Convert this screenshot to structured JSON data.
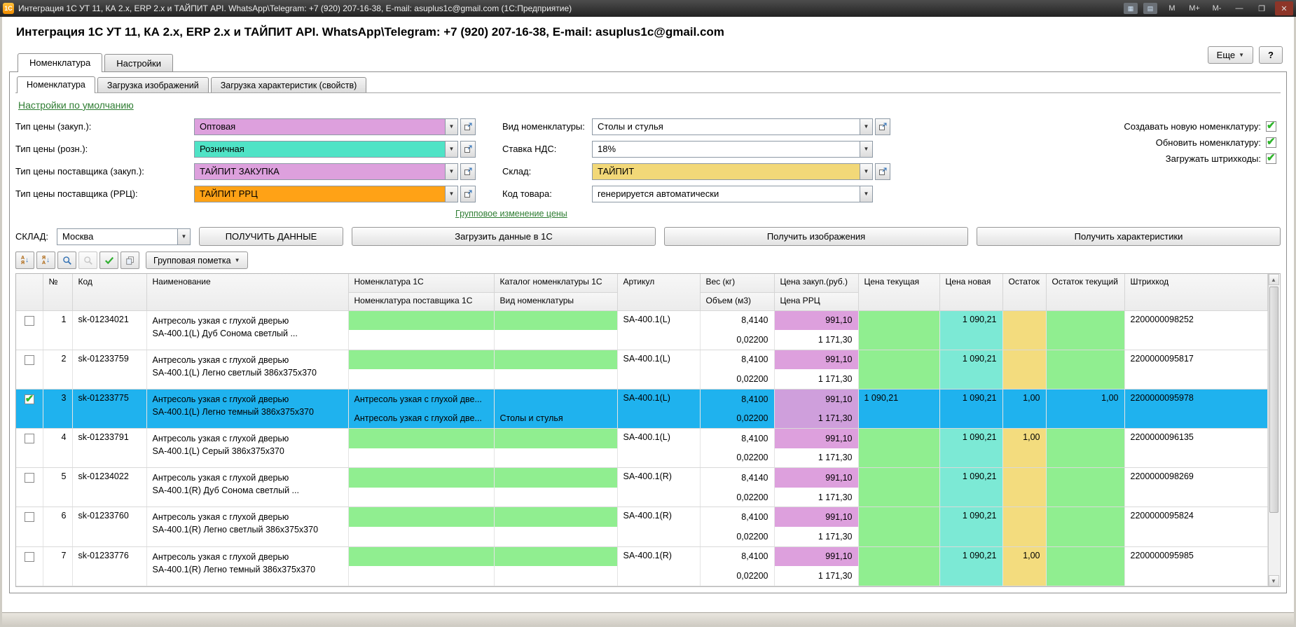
{
  "colors": {
    "selection": "#1fb2ee",
    "cell_green": "#90ee90",
    "cell_pink": "#dda0dd",
    "cell_cyan": "#7ce9d5",
    "cell_yellow": "#f3dc7e",
    "link_green": "#2e7d32",
    "check_green": "#2eb52a"
  },
  "titlebar": {
    "logo_text": "1С",
    "app_title": "Интеграция 1С УТ 11, КА 2.х, ERP 2.х и ТАЙПИТ API. WhatsApp\\Telegram: +7 (920) 207-16-38, E-mail: asuplus1c@gmail.com  (1С:Предприятие)",
    "scale_m": "М",
    "scale_m_plus": "М+",
    "scale_m_minus": "М-",
    "minimize": "—",
    "maximize": "❐",
    "close": "✕"
  },
  "header": {
    "title": "Интеграция 1С УТ 11, КА 2.х, ERP 2.х и ТАЙПИТ API. WhatsApp\\Telegram: +7 (920) 207-16-38, E-mail: asuplus1c@gmail.com",
    "more_button": "Еще",
    "help_button": "?"
  },
  "outer_tabs": [
    {
      "label": "Номенклатура",
      "active": true
    },
    {
      "label": "Настройки",
      "active": false
    }
  ],
  "inner_tabs": [
    {
      "label": "Номенклатура",
      "active": true
    },
    {
      "label": "Загрузка изображений",
      "active": false
    },
    {
      "label": "Загрузка характеристик (свойств)",
      "active": false
    }
  ],
  "links": {
    "default_settings": "Настройки по умолчанию",
    "group_price_change": "Групповое изменение цены"
  },
  "form": {
    "left": [
      {
        "label": "Тип цены (закуп.):",
        "value": "Оптовая",
        "color": "#dda0dd"
      },
      {
        "label": "Тип цены (розн.):",
        "value": "Розничная",
        "color": "#4fe3c6"
      },
      {
        "label": "Тип цены поставщика (закуп.):",
        "value": "ТАЙПИТ ЗАКУПКА",
        "color": "#dda0dd"
      },
      {
        "label": "Тип цены поставщика (РРЦ):",
        "value": "ТАЙПИТ РРЦ",
        "color": "#ffa216"
      }
    ],
    "middle": [
      {
        "label": "Вид номенклатуры:",
        "value": "Столы и стулья",
        "color": "#ffffff"
      },
      {
        "label": "Ставка НДС:",
        "value": "18%",
        "color": "#ffffff"
      },
      {
        "label": "Склад:",
        "value": "ТАЙПИТ",
        "color": "#f2d878"
      },
      {
        "label": "Код товара:",
        "value": "генерируется автоматически",
        "color": "#ffffff"
      }
    ],
    "checkboxes": [
      {
        "label": "Создавать новую номенклатуру:",
        "checked": true
      },
      {
        "label": "Обновить номенклатуру:",
        "checked": true
      },
      {
        "label": "Загружать штрихкоды:",
        "checked": true
      }
    ]
  },
  "actions": {
    "sklad_label": "СКЛАД:",
    "sklad_value": "Москва",
    "get_data": "ПОЛУЧИТЬ ДАННЫЕ",
    "load_to_1c": "Загрузить данные в 1С",
    "get_images": "Получить изображения",
    "get_characteristics": "Получить характеристики"
  },
  "toolbar": {
    "icons": [
      "sort-ascending",
      "sort-descending",
      "search",
      "search-cancel",
      "mark",
      "copy"
    ],
    "group_mark_label": "Групповая пометка"
  },
  "table": {
    "headers": {
      "num": "№",
      "code": "Код",
      "name": "Наименование",
      "nom_1c": "Номенклатура 1С",
      "nom_supplier": "Номенклатура поставщика 1С",
      "catalog": "Каталог номенклатуры 1С",
      "nom_type": "Вид номенклатуры",
      "article": "Артикул",
      "weight": "Вес (кг)",
      "volume": "Объем (м3)",
      "price_purchase": "Цена закуп.(руб.)",
      "price_rrc": "Цена РРЦ",
      "price_current": "Цена текущая",
      "price_new": "Цена новая",
      "stock": "Остаток",
      "stock_current": "Остаток текущий",
      "barcode": "Штрихкод"
    },
    "rows": [
      {
        "checked": false,
        "selected": false,
        "num": "1",
        "code": "sk-01234021",
        "name_line1": "Антресоль узкая с глухой дверью",
        "name_line2": "SA-400.1(L) Дуб Сонома светлый ...",
        "nom_1c": "",
        "nom_supplier": "",
        "catalog_1c": "",
        "nom_type": "",
        "article": "SA-400.1(L)",
        "weight": "8,4140",
        "volume": "0,02200",
        "price_purchase": "991,10",
        "price_rrc": "1 171,30",
        "price_current": "",
        "price_new": "1 090,21",
        "stock": "",
        "stock_current": "",
        "barcode": "2200000098252"
      },
      {
        "checked": false,
        "selected": false,
        "num": "2",
        "code": "sk-01233759",
        "name_line1": "Антресоль узкая с глухой дверью",
        "name_line2": "SA-400.1(L) Легно светлый 386х375х370",
        "nom_1c": "",
        "nom_supplier": "",
        "catalog_1c": "",
        "nom_type": "",
        "article": "SA-400.1(L)",
        "weight": "8,4100",
        "volume": "0,02200",
        "price_purchase": "991,10",
        "price_rrc": "1 171,30",
        "price_current": "",
        "price_new": "1 090,21",
        "stock": "",
        "stock_current": "",
        "barcode": "2200000095817"
      },
      {
        "checked": true,
        "selected": true,
        "num": "3",
        "code": "sk-01233775",
        "name_line1": "Антресоль узкая с глухой дверью",
        "name_line2": "SA-400.1(L) Легно темный 386х375х370",
        "nom_1c": "Антресоль узкая с глухой две...",
        "nom_supplier": "Антресоль узкая с глухой две...",
        "catalog_1c": "",
        "nom_type": "Столы и стулья",
        "article": "SA-400.1(L)",
        "weight": "8,4100",
        "volume": "0,02200",
        "price_purchase": "991,10",
        "price_rrc": "1 171,30",
        "price_current": "1 090,21",
        "price_new": "1 090,21",
        "stock": "1,00",
        "stock_current": "1,00",
        "barcode": "2200000095978"
      },
      {
        "checked": false,
        "selected": false,
        "num": "4",
        "code": "sk-01233791",
        "name_line1": "Антресоль узкая с глухой дверью",
        "name_line2": "SA-400.1(L) Серый 386х375х370",
        "nom_1c": "",
        "nom_supplier": "",
        "catalog_1c": "",
        "nom_type": "",
        "article": "SA-400.1(L)",
        "weight": "8,4100",
        "volume": "0,02200",
        "price_purchase": "991,10",
        "price_rrc": "1 171,30",
        "price_current": "",
        "price_new": "1 090,21",
        "stock": "1,00",
        "stock_current": "",
        "barcode": "2200000096135"
      },
      {
        "checked": false,
        "selected": false,
        "num": "5",
        "code": "sk-01234022",
        "name_line1": "Антресоль узкая с глухой дверью",
        "name_line2": "SA-400.1(R) Дуб Сонома светлый ...",
        "nom_1c": "",
        "nom_supplier": "",
        "catalog_1c": "",
        "nom_type": "",
        "article": "SA-400.1(R)",
        "weight": "8,4140",
        "volume": "0,02200",
        "price_purchase": "991,10",
        "price_rrc": "1 171,30",
        "price_current": "",
        "price_new": "1 090,21",
        "stock": "",
        "stock_current": "",
        "barcode": "2200000098269"
      },
      {
        "checked": false,
        "selected": false,
        "num": "6",
        "code": "sk-01233760",
        "name_line1": "Антресоль узкая с глухой дверью",
        "name_line2": "SA-400.1(R) Легно светлый 386х375х370",
        "nom_1c": "",
        "nom_supplier": "",
        "catalog_1c": "",
        "nom_type": "",
        "article": "SA-400.1(R)",
        "weight": "8,4100",
        "volume": "0,02200",
        "price_purchase": "991,10",
        "price_rrc": "1 171,30",
        "price_current": "",
        "price_new": "1 090,21",
        "stock": "",
        "stock_current": "",
        "barcode": "2200000095824"
      },
      {
        "checked": false,
        "selected": false,
        "num": "7",
        "code": "sk-01233776",
        "name_line1": "Антресоль узкая с глухой дверью",
        "name_line2": "SA-400.1(R) Легно темный 386х375х370",
        "nom_1c": "",
        "nom_supplier": "",
        "catalog_1c": "",
        "nom_type": "",
        "article": "SA-400.1(R)",
        "weight": "8,4100",
        "volume": "0,02200",
        "price_purchase": "991,10",
        "price_rrc": "1 171,30",
        "price_current": "",
        "price_new": "1 090,21",
        "stock": "1,00",
        "stock_current": "",
        "barcode": "2200000095985"
      }
    ]
  }
}
